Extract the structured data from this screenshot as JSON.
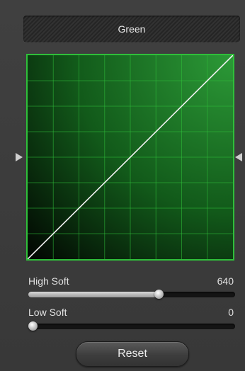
{
  "channel": {
    "name": "Green",
    "curve_color": "#2fbf3a"
  },
  "curve": {
    "points": [
      [
        0,
        0
      ],
      [
        1,
        1
      ]
    ],
    "grid_divisions": 8
  },
  "high_soft": {
    "label": "High Soft",
    "value": "640",
    "level": 0.64
  },
  "low_soft": {
    "label": "Low Soft",
    "value": "0",
    "level": 0.0
  },
  "reset": {
    "label": "Reset"
  },
  "icons": {
    "left_handle": "triangle-right-icon",
    "right_handle": "triangle-left-icon"
  }
}
